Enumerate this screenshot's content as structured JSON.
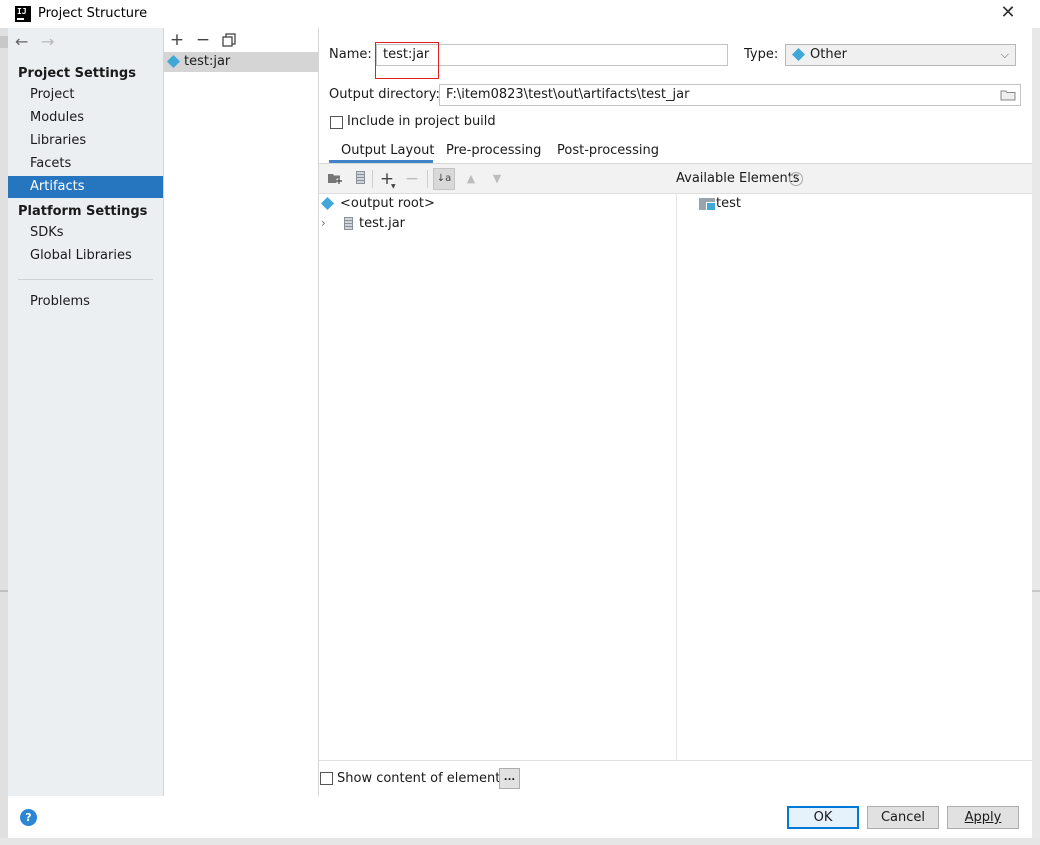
{
  "window": {
    "title": "Project Structure"
  },
  "sidebar": {
    "project_settings_header": "Project Settings",
    "project_items": [
      "Project",
      "Modules",
      "Libraries",
      "Facets",
      "Artifacts"
    ],
    "selected": "Artifacts",
    "platform_settings_header": "Platform Settings",
    "platform_items": [
      "SDKs",
      "Global Libraries"
    ],
    "problems": "Problems"
  },
  "artifacts_list": {
    "items": [
      "test:jar"
    ]
  },
  "form": {
    "name_label": "Name:",
    "name_value": "test:jar",
    "type_label": "Type:",
    "type_value": "Other",
    "output_dir_label": "Output directory:",
    "output_dir_value": "F:\\item0823\\test\\out\\artifacts\\test_jar",
    "include_build_label": "Include in project build",
    "include_build_checked": false
  },
  "tabs": [
    "Output Layout",
    "Pre-processing",
    "Post-processing"
  ],
  "active_tab": "Output Layout",
  "output_tree": {
    "root": "<output root>",
    "children": [
      "test.jar"
    ]
  },
  "available": {
    "title": "Available Elements",
    "items": [
      "test"
    ]
  },
  "show_content_label": "Show content of elements",
  "ellipsis_label": "...",
  "buttons": {
    "ok": "OK",
    "cancel": "Cancel",
    "apply": "Apply",
    "help": "?"
  },
  "colors": {
    "selection": "#2675bf",
    "accent": "#4083c9",
    "highlight_box": "#e02020"
  }
}
